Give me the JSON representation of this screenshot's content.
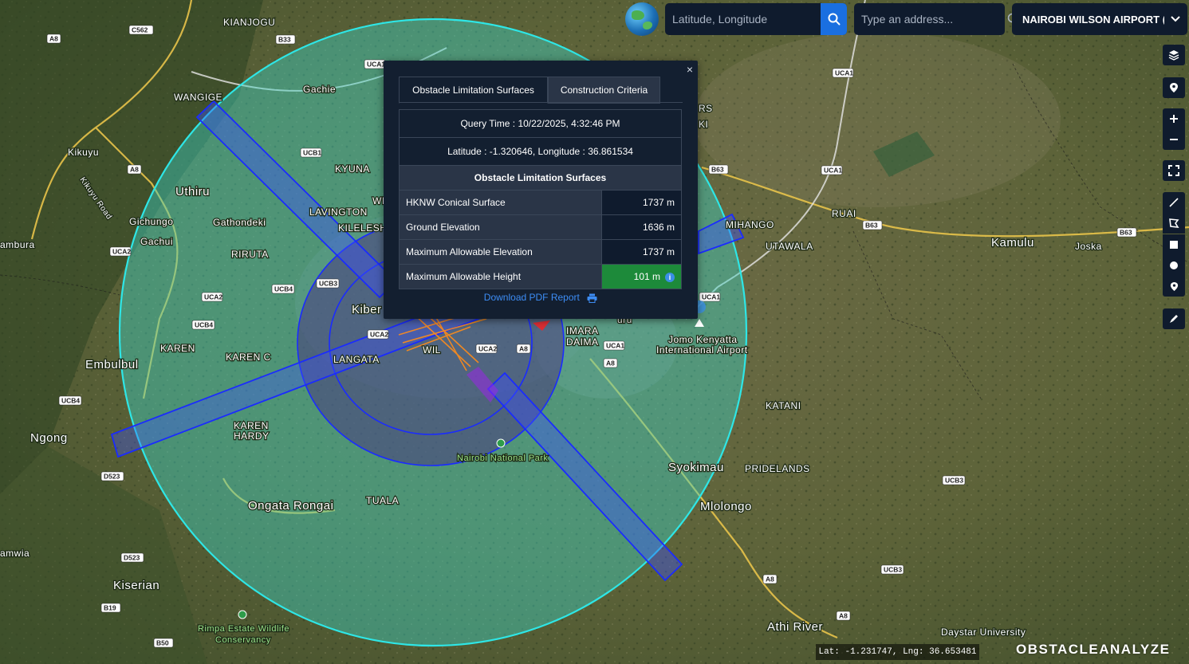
{
  "toolbar": {
    "coord_placeholder": "Latitude, Longitude",
    "address_placeholder": "Type an address...",
    "airport_selected": "NAIROBI WILSON AIRPORT (HI"
  },
  "popup": {
    "tabs": [
      "Obstacle Limitation Surfaces",
      "Construction Criteria"
    ],
    "query_time": "Query Time : 10/22/2025, 4:32:46 PM",
    "lat_lng": "Latitude : -1.320646, Longitude : 36.861534",
    "section_title": "Obstacle Limitation Surfaces",
    "rows": [
      {
        "label": "HKNW Conical Surface",
        "value": "1737 m"
      },
      {
        "label": "Ground Elevation",
        "value": "1636 m"
      },
      {
        "label": "Maximum Allowable Elevation",
        "value": "1737 m"
      },
      {
        "label": "Maximum Allowable Height",
        "value": "101 m"
      }
    ],
    "download_label": "Download PDF Report",
    "close_label": "×",
    "info_label": "i"
  },
  "status": {
    "coords": "Lat: -1.231747, Lng: 36.653481",
    "brand": "OBSTACLEANALYZE"
  },
  "map": {
    "places": [
      "KIANJOGU",
      "Gachie",
      "WANGIGE",
      "Kikuyu",
      "Kikuyu Road",
      "Uthiru",
      "KYUNA",
      "LAVINGTON",
      "KILELESHWA",
      "Gathondeki",
      "Gichungo",
      "Gachui",
      "RIRUTA",
      "ambura",
      "Kiber",
      "KAREN",
      "KAREN C",
      "LANGATA",
      "WIL",
      "Embulbul",
      "Ngong",
      "KAREN HARDY",
      "Nairobi National Park",
      "TUALA",
      "Ongata Rongai",
      "amwia",
      "Kiserian",
      "Rimpa Estate Wildlife Conservancy",
      "MIHANGO",
      "RUAI",
      "UTAWALA",
      "Kamulu",
      "Joska",
      "IMARA DAIMA",
      "Jomo Kenyatta International Airport",
      "KATANI",
      "PRIDELANDS",
      "Syokimau",
      "Mlolongo",
      "Athi River",
      "Daystar University",
      "RS",
      "KI",
      "uru",
      "WI"
    ],
    "roads": [
      "A8",
      "C562",
      "B33",
      "UCA1",
      "UCB1",
      "UCA2",
      "UCB4",
      "UCB3",
      "B63",
      "D523",
      "B19",
      "B50",
      "UCA1",
      "UCB3"
    ]
  },
  "colors": {
    "conical": "#2ee6e6",
    "runway_strip": "#1a2bff",
    "max_height_good": "#1d8a3a",
    "panel_bg": "#131f30",
    "accent_blue": "#1a6fe0"
  },
  "icons": [
    "globe-icon",
    "search-icon",
    "chevron-down-icon",
    "layers-icon",
    "pin-icon",
    "zoom-in-icon",
    "zoom-out-icon",
    "fullscreen-icon",
    "draw-line-icon",
    "draw-polygon-icon",
    "draw-rectangle-icon",
    "draw-circle-icon",
    "draw-marker-icon",
    "edit-icon",
    "print-icon",
    "info-icon",
    "close-icon"
  ]
}
